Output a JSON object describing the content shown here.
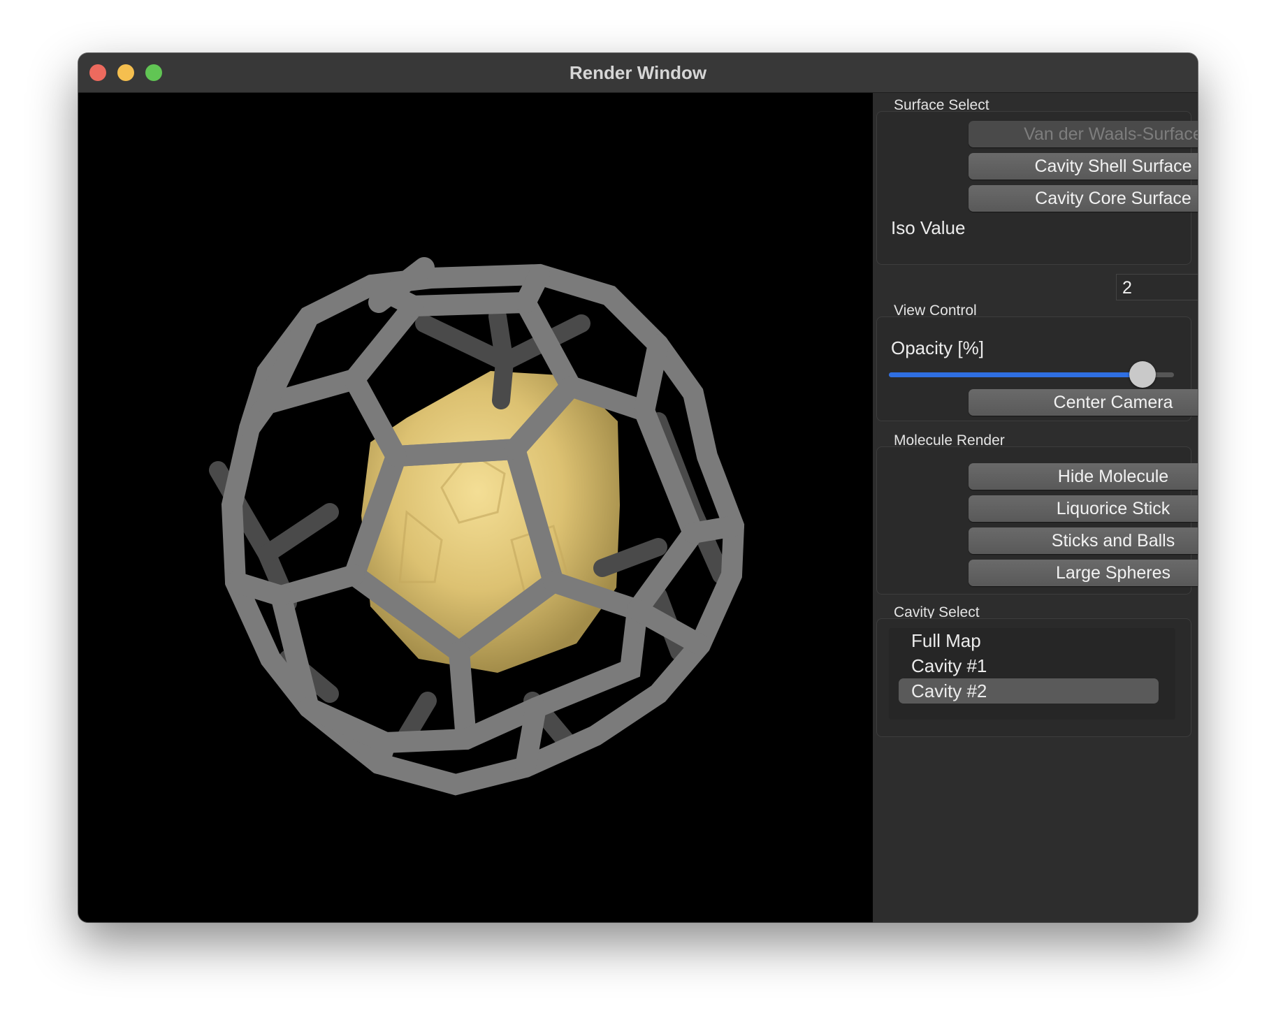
{
  "window": {
    "title": "Render Window"
  },
  "surface_select": {
    "title": "Surface Select",
    "buttons": [
      "Van der Waals-Surface",
      "Cavity Shell Surface",
      "Cavity Core Surface"
    ],
    "iso_label": "Iso Value",
    "iso_value": "2"
  },
  "view_control": {
    "title": "View Control",
    "opacity_label": "Opacity [%]",
    "opacity_value_fraction": 0.89,
    "center_button": "Center Camera"
  },
  "molecule_render": {
    "title": "Molecule Render",
    "buttons": [
      "Hide Molecule",
      "Liquorice Stick",
      "Sticks and Balls",
      "Large Spheres"
    ]
  },
  "cavity_select": {
    "title": "Cavity Select",
    "items": [
      "Full Map",
      "Cavity #1",
      "Cavity #2"
    ],
    "selected": "Cavity #2"
  },
  "colors": {
    "accent": "#2f6fe2",
    "viewport_bg": "#000000",
    "surface": "#e8cf7a",
    "bonds": "#7a7a7a"
  }
}
